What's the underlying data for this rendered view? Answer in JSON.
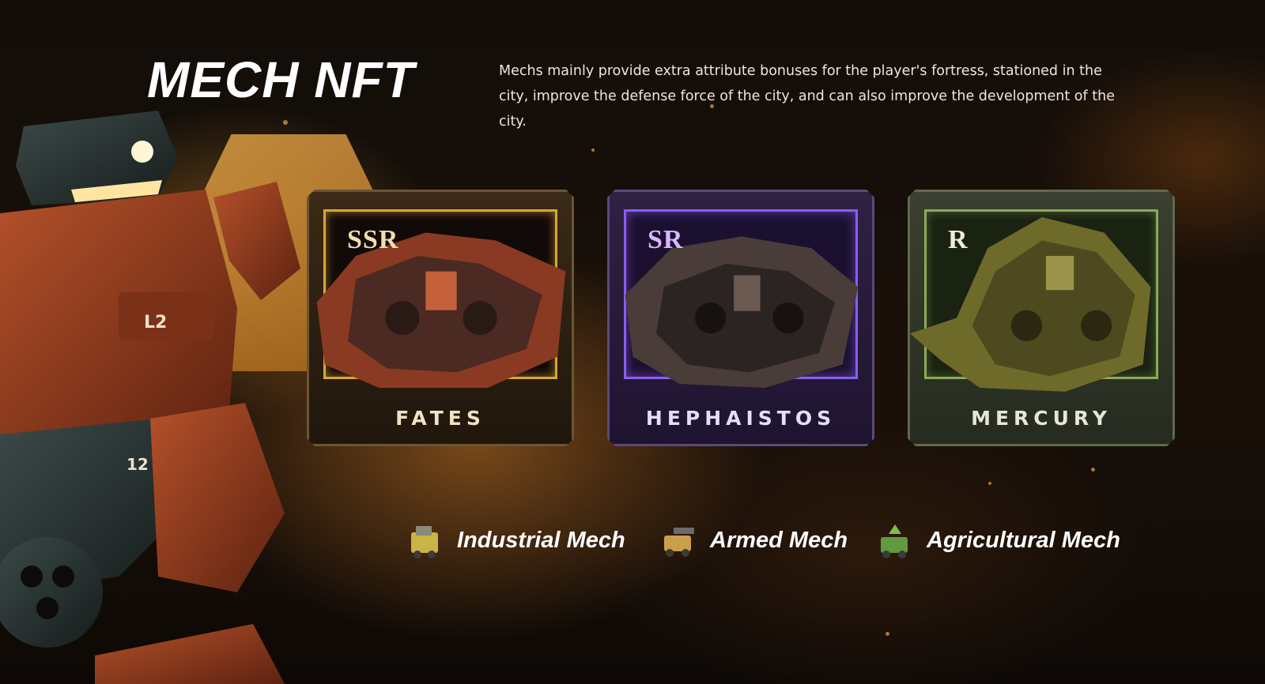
{
  "page": {
    "title": "MECH NFT",
    "description": "Mechs mainly provide extra attribute bonuses for the player's fortress, stationed in the city, improve the defense force of the city, and can also improve the development of the city."
  },
  "cards": [
    {
      "rarity": "SSR",
      "name": "FATES",
      "accent": "#d9a538"
    },
    {
      "rarity": "SR",
      "name": "HEPHAISTOS",
      "accent": "#8a5df0"
    },
    {
      "rarity": "R",
      "name": "MERCURY",
      "accent": "#8ca85a"
    }
  ],
  "categories": [
    {
      "label": "Industrial Mech",
      "icon": "industrial-mech-icon"
    },
    {
      "label": "Armed Mech",
      "icon": "armed-mech-icon"
    },
    {
      "label": "Agricultural Mech",
      "icon": "agricultural-mech-icon"
    }
  ],
  "hero_mech": {
    "markings": [
      "L2",
      "12"
    ]
  }
}
